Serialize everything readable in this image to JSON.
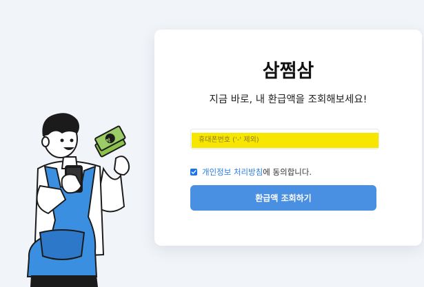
{
  "app": {
    "title": "삼쩜삼"
  },
  "hero": {
    "subtitle": "지금 바로, 내 환급액을 조회해보세요!"
  },
  "form": {
    "phone_placeholder": "휴대폰번호 ('-' 제외)",
    "phone_value": "",
    "consent_checked": true,
    "consent_link": "개인정보 처리방침",
    "consent_suffix": "에 동의합니다.",
    "submit_label": "환급액 조회하기"
  },
  "illustration": {
    "money_symbol": "₩"
  },
  "colors": {
    "background": "#f1f4f8",
    "primary_button": "#4a90e2",
    "link": "#2a7de1",
    "highlight": "#f7e600"
  }
}
